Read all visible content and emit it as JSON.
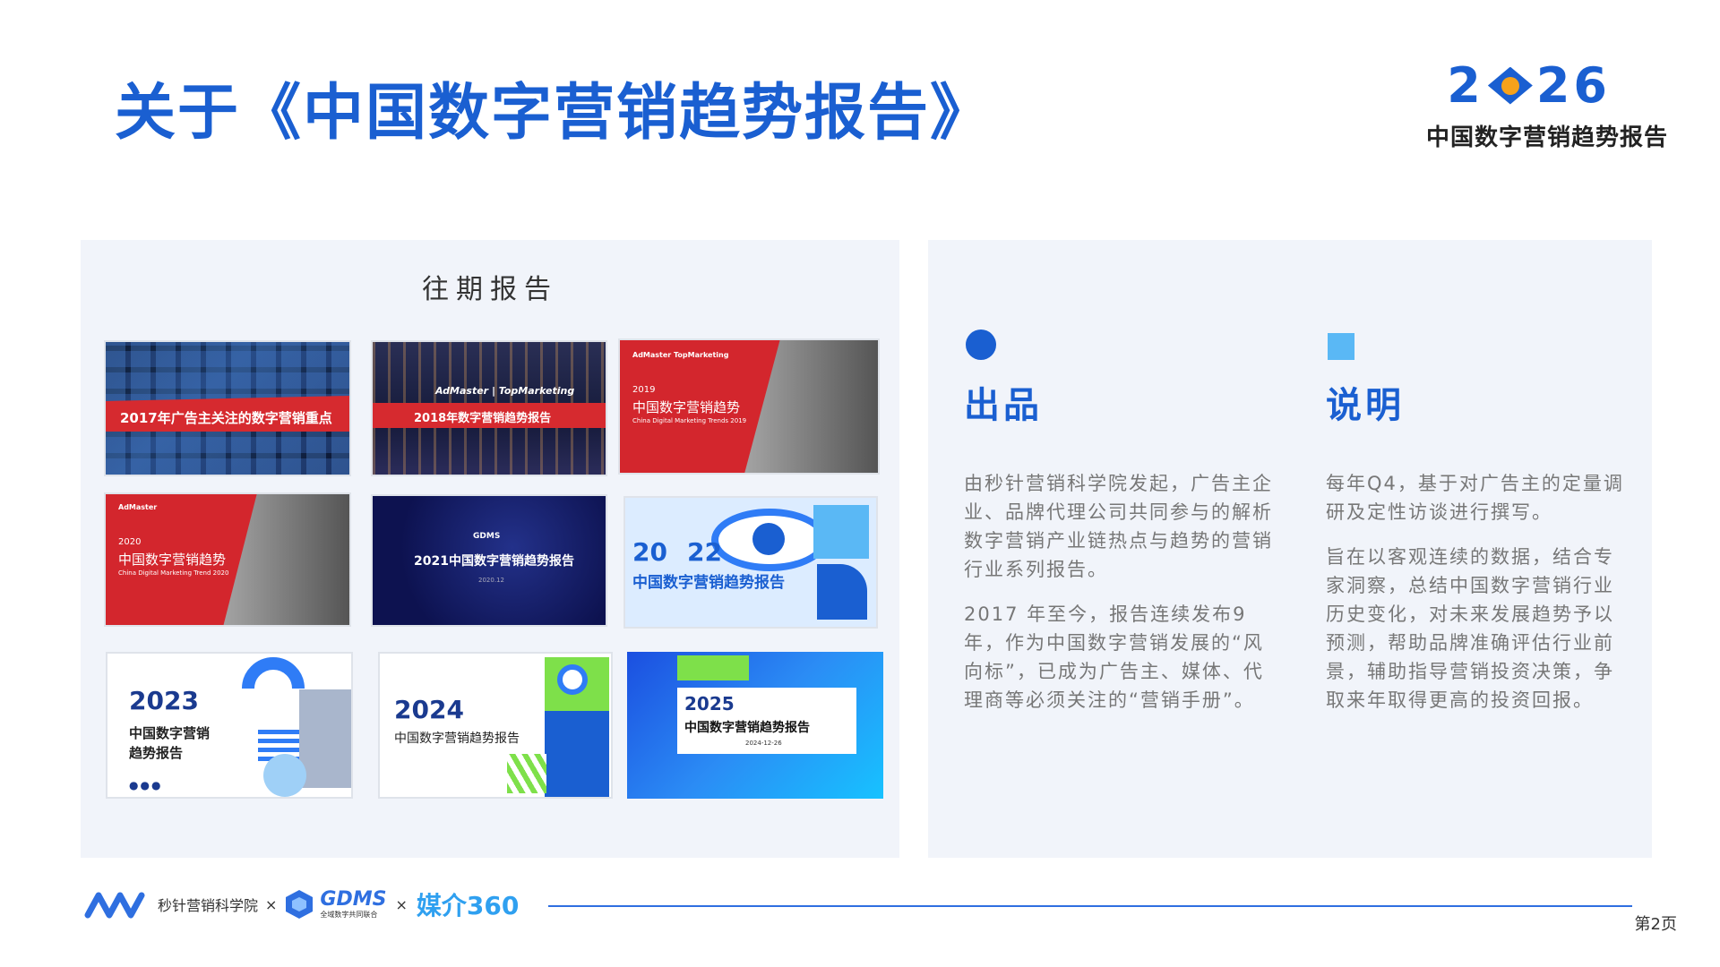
{
  "header": {
    "title": "关于《中国数字营销趋势报告》",
    "logo_year_left": "2",
    "logo_year_right": "26",
    "subtitle": "中国数字营销趋势报告"
  },
  "left_panel": {
    "title": "往期报告",
    "reports": [
      {
        "label": "2017年广告主关注的数字营销重点"
      },
      {
        "label": "2018年数字营销趋势报告",
        "brand": "AdMaster | TopMarketing"
      },
      {
        "year": "2019",
        "label": "中国数字营销趋势",
        "en": "China Digital Marketing Trends 2019",
        "brand": "AdMaster TopMarketing"
      },
      {
        "year": "2020",
        "label": "中国数字营销趋势",
        "en": "China Digital Marketing Trend 2020",
        "brand": "AdMaster"
      },
      {
        "label": "2021中国数字营销趋势报告",
        "brand": "GDMS",
        "date": "2020.12"
      },
      {
        "year_left": "20",
        "year_right": "22",
        "label": "中国数字营销趋势报告"
      },
      {
        "year_left": "20",
        "year_right": "23",
        "label": "中国数字营销\n趋势报告"
      },
      {
        "year_left": "20",
        "year_right": "24",
        "label": "中国数字营销趋势报告"
      },
      {
        "year_left": "20",
        "year_right": "25",
        "label": "中国数字营销趋势报告",
        "date": "2024-12-26"
      }
    ]
  },
  "right_panel": {
    "col1": {
      "heading": "出品",
      "paragraphs": [
        "由秒针营销科学院发起，广告主企业、品牌代理公司共同参与的解析数字营销产业链热点与趋势的营销行业系列报告。",
        "2017 年至今，报告连续发布9年，作为中国数字营销发展的“风向标”，已成为广告主、媒体、代理商等必须关注的“营销手册”。"
      ]
    },
    "col2": {
      "heading": "说明",
      "paragraphs": [
        "每年Q4，基于对广告主的定量调研及定性访谈进行撰写。",
        "旨在以客观连续的数据，结合专家洞察，总结中国数字营销行业历史变化，对未来发展趋势予以预测，帮助品牌准确评估行业前景，辅助指导营销投资决策，争取来年取得更高的投资回报。"
      ]
    }
  },
  "footer": {
    "org1": "秒针营销科学院",
    "sep": "×",
    "org2": "GDMS",
    "org2_sub": "全域数字共同联合",
    "org3": "媒介360",
    "page": "第2页"
  },
  "colors": {
    "brand_blue": "#1a5fd1",
    "panel_bg": "#f1f4fa",
    "accent_light_blue": "#5ab8f5",
    "report_red": "#d62a2f"
  }
}
